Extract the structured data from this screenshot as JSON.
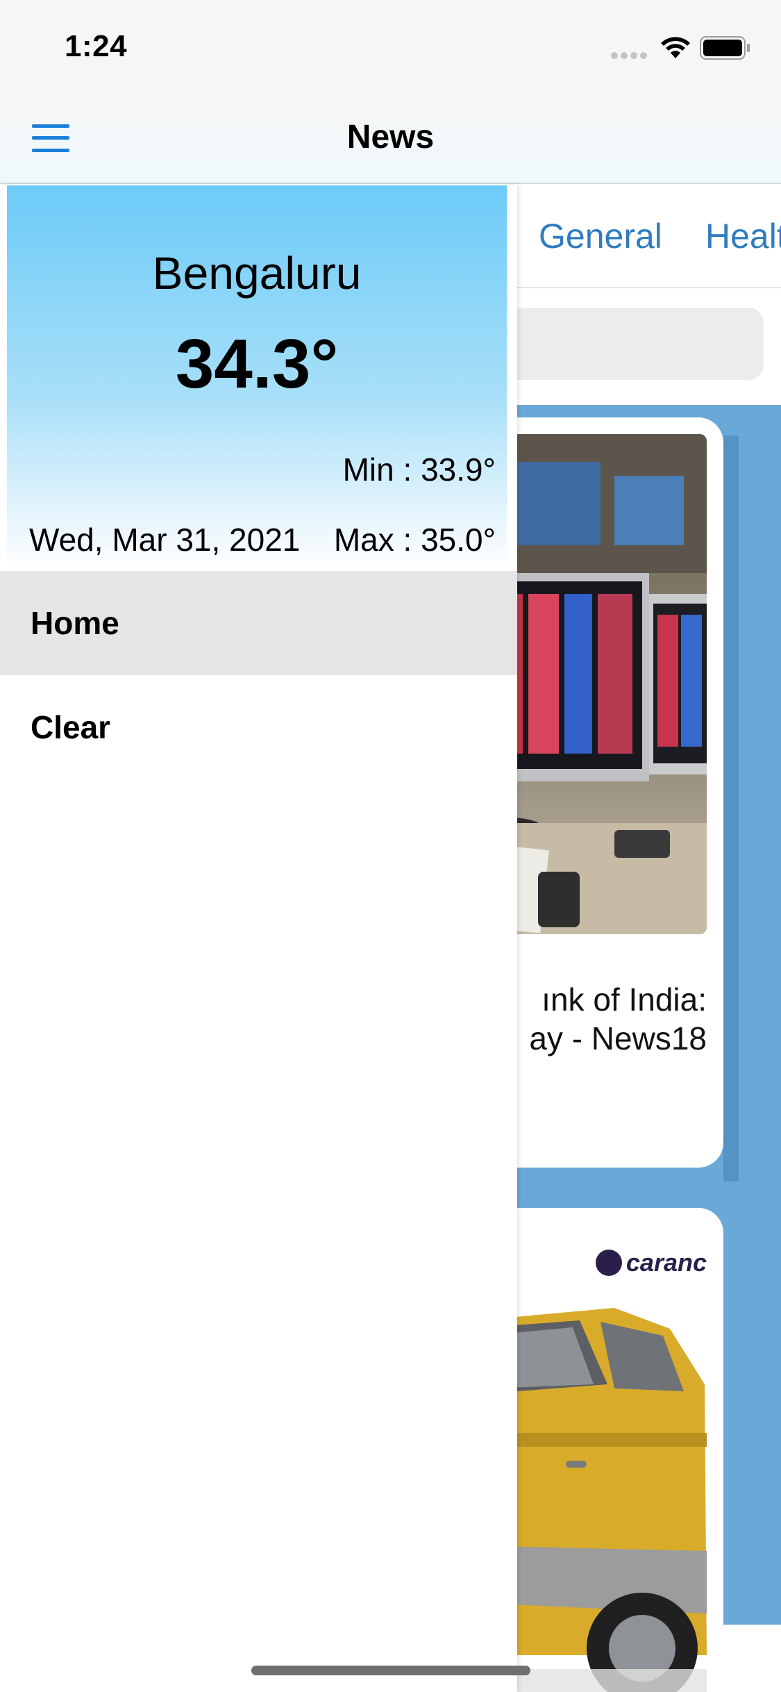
{
  "status_bar": {
    "time": "1:24",
    "icons": [
      "signal-dots-icon",
      "wifi-icon",
      "battery-icon"
    ]
  },
  "nav": {
    "title": "News",
    "menu_icon": "hamburger-menu-icon",
    "accent_color": "#1a7fd8"
  },
  "background_feed": {
    "tabs": [
      {
        "label": "General"
      },
      {
        "label": "Healt"
      }
    ],
    "tab_color": "#2f7cc0",
    "feed_color": "#6aa8d7",
    "cards": [
      {
        "headline": "ınk of India:\nay - News18"
      },
      {
        "logo_text": "caranc"
      }
    ]
  },
  "drawer": {
    "weather": {
      "city": "Bengaluru",
      "temperature": "34.3°",
      "min": "Min : 33.9°",
      "max": "Max : 35.0°",
      "date": "Wed, Mar 31, 2021"
    },
    "menu": [
      {
        "label": "Home",
        "selected": true
      },
      {
        "label": "Clear",
        "selected": false
      }
    ]
  }
}
